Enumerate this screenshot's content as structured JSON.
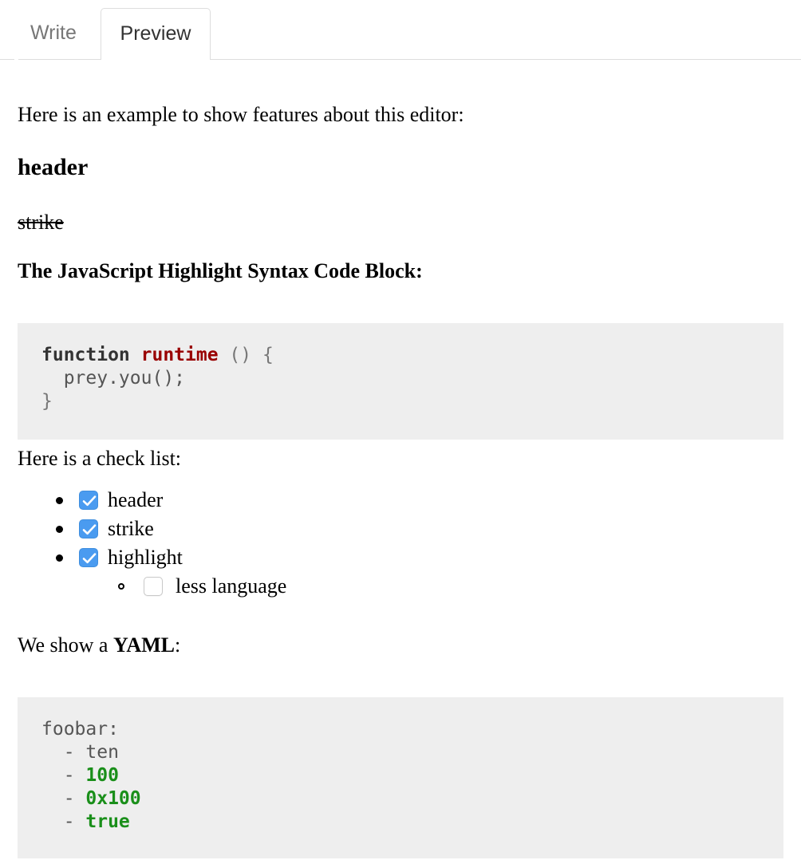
{
  "tabs": [
    {
      "label": "Write",
      "active": false,
      "name": "tab-write"
    },
    {
      "label": "Preview",
      "active": true,
      "name": "tab-preview"
    }
  ],
  "content": {
    "intro": "Here is an example to show features about this editor:",
    "header": "header",
    "strike": "strike",
    "js_block_caption_bold": "The JavaScript Highlight Syntax Code Block",
    "js_block_caption_tail": ":",
    "checklist_caption": "Here is a check list:",
    "yaml_caption_lead": "We show a ",
    "yaml_caption_bold": "YAML",
    "yaml_caption_tail": ":"
  },
  "code_js": {
    "language": "javascript",
    "lines": [
      {
        "tokens": [
          {
            "text": "function",
            "kind": "keyword"
          },
          {
            "text": " ",
            "kind": "plain"
          },
          {
            "text": "runtime",
            "kind": "title"
          },
          {
            "text": " () {",
            "kind": "punct"
          }
        ]
      },
      {
        "tokens": [
          {
            "text": "  prey.you();",
            "kind": "plain"
          }
        ]
      },
      {
        "tokens": [
          {
            "text": "}",
            "kind": "punct"
          }
        ]
      }
    ],
    "raw": "function runtime () {\n  prey.you();\n}"
  },
  "code_yaml": {
    "language": "yaml",
    "lines": [
      {
        "tokens": [
          {
            "text": "foobar:",
            "kind": "attr"
          }
        ]
      },
      {
        "tokens": [
          {
            "text": "  - ",
            "kind": "dash"
          },
          {
            "text": "ten",
            "kind": "plain"
          }
        ]
      },
      {
        "tokens": [
          {
            "text": "  - ",
            "kind": "dash"
          },
          {
            "text": "100",
            "kind": "number"
          }
        ]
      },
      {
        "tokens": [
          {
            "text": "  - ",
            "kind": "dash"
          },
          {
            "text": "0x100",
            "kind": "number"
          }
        ]
      },
      {
        "tokens": [
          {
            "text": "  - ",
            "kind": "dash"
          },
          {
            "text": "true",
            "kind": "bool"
          }
        ]
      }
    ],
    "raw": "foobar:\n  - ten\n  - 100\n  - 0x100\n  - true"
  },
  "checklist": [
    {
      "label": "header",
      "checked": true,
      "level": 1,
      "bullet": "disc"
    },
    {
      "label": "strike",
      "checked": true,
      "level": 1,
      "bullet": "disc"
    },
    {
      "label": "highlight",
      "checked": true,
      "level": 1,
      "bullet": "disc"
    },
    {
      "label": "less language",
      "checked": false,
      "level": 2,
      "bullet": "circle"
    }
  ],
  "colors": {
    "page_background": "#ffffff",
    "code_background": "#eeeeee",
    "border": "#dddddd",
    "tab_inactive_text": "#777777",
    "tab_active_text": "#333333",
    "code_keyword": "#333333",
    "code_title": "#990000",
    "code_punct": "#777777",
    "code_plain": "#555555",
    "code_number": "#1a8f1a",
    "checkbox_checked": "#4a9bf0",
    "checkbox_unchecked_border": "#c8c8c8"
  }
}
